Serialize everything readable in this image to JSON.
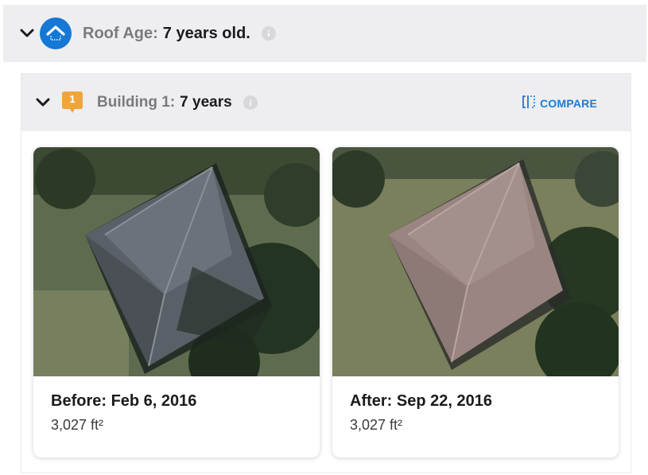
{
  "roof_age": {
    "label": "Roof Age:",
    "value": "7 years old.",
    "badge_color": "#1478d4",
    "icon": "house-roof-icon"
  },
  "building": {
    "badge_number": "1",
    "badge_color": "#f0a53a",
    "label": "Building 1:",
    "value": "7 years",
    "compare_label": "COMPARE",
    "compare_icon": "compare-split-icon",
    "accent_color": "#1a7ad4"
  },
  "images": [
    {
      "id": "before",
      "title": "Before: Feb 6, 2016",
      "area": "3,027 ft²"
    },
    {
      "id": "after",
      "title": "After: Sep 22, 2016",
      "area": "3,027 ft²"
    }
  ]
}
